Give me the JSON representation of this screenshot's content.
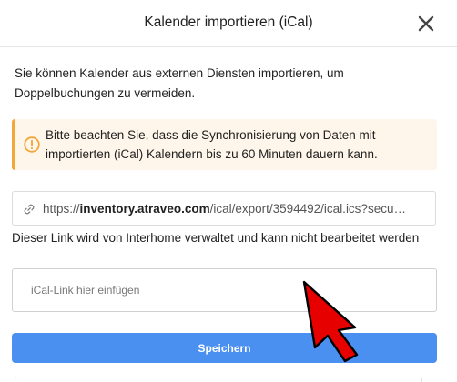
{
  "dialog": {
    "title": "Kalender importieren (iCal)",
    "close_icon": "close-icon"
  },
  "intro": {
    "text": "Sie können Kalender aus externen Diensten importieren, um Doppelbuchungen zu vermeiden."
  },
  "alert": {
    "icon": "warning-icon",
    "text": "Bitte beachten Sie, dass die Synchronisierung von Daten mit importierten (iCal) Kalendern bis zu 60 Minuten dauern kann.",
    "accent_color": "#f3a73b",
    "background_color": "#fef6ea"
  },
  "export_link": {
    "icon": "link-icon",
    "prefix": "https://",
    "domain": "inventory.atraveo.com",
    "path": "/ical/export/3594492/ical.ics?secu…",
    "note": "Dieser Link wird von Interhome verwaltet und kann nicht bearbeitet werden"
  },
  "import": {
    "placeholder": "iCal-Link hier einfügen",
    "value": ""
  },
  "save_button": {
    "label": "Speichern",
    "color": "#4a90f0"
  },
  "overlay": {
    "cursor_icon": "red-arrow-cursor-icon",
    "cursor_color": "#e60000"
  }
}
